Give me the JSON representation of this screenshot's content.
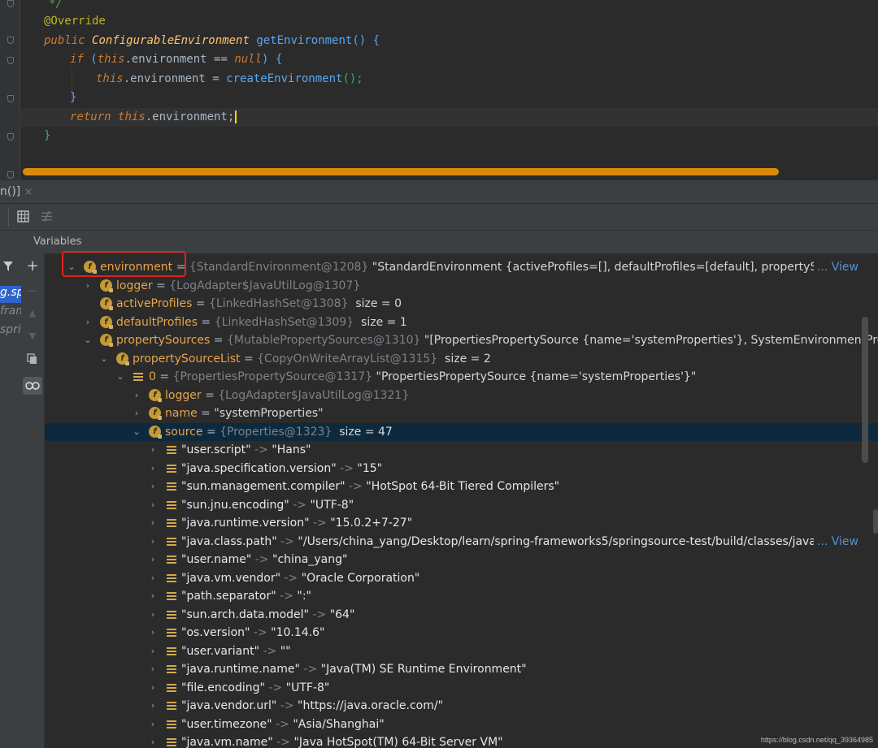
{
  "editor": {
    "lines": {
      "comment_end": "*/",
      "annotation": "@Override",
      "l_public": "public",
      "l_type": "ConfigurableEnvironment",
      "l_method": "getEnvironment",
      "l_parens": "()",
      "l_brace": "{",
      "if_kw": "if",
      "if_this": "this",
      "if_field": ".environment == ",
      "if_null": "null",
      "if_close": ") {",
      "if_open": "(",
      "assign_this": "this",
      "assign_field": ".environment = ",
      "assign_call": "createEnvironment",
      "assign_end": "();",
      "close_if": "}",
      "return_kw": "return",
      "return_this": "this",
      "return_field": ".environment;",
      "close_method": "}"
    },
    "scrollbar_color": "#d98a0a"
  },
  "debug": {
    "tab_label": "n()]",
    "tab_close": "×",
    "variables_title": "Variables",
    "frames": [
      {
        "label": "g.sp",
        "selected": true
      },
      {
        "label": "fram",
        "selected": false
      },
      {
        "label": "spri",
        "selected": false
      }
    ]
  },
  "tree": {
    "rows": [
      {
        "name": "environment",
        "ref": "{StandardEnvironment@1208}",
        "val": "\"StandardEnvironment {activeProfiles=[], defaultProfiles=[default], propertySource",
        "view": "... View"
      },
      {
        "name": "logger",
        "ref": "{LogAdapter$JavaUtilLog@1307}"
      },
      {
        "name": "activeProfiles",
        "ref": "{LinkedHashSet@1308}",
        "size": "size = 0"
      },
      {
        "name": "defaultProfiles",
        "ref": "{LinkedHashSet@1309}",
        "size": "size = 1"
      },
      {
        "name": "propertySources",
        "ref": "{MutablePropertySources@1310}",
        "val": "\"[PropertiesPropertySource {name='systemProperties'}, SystemEnvironmentPro"
      },
      {
        "name": "propertySourceList",
        "ref": "{CopyOnWriteArrayList@1315}",
        "size": "size = 2"
      },
      {
        "name": "0",
        "ref": "{PropertiesPropertySource@1317}",
        "val": "\"PropertiesPropertySource {name='systemProperties'}\""
      },
      {
        "name": "logger",
        "ref": "{LogAdapter$JavaUtilLog@1321}"
      },
      {
        "name": "name",
        "val": "\"systemProperties\""
      },
      {
        "name": "source",
        "ref": "{Properties@1323}",
        "size": "size = 47"
      }
    ],
    "entries": [
      {
        "k": "\"user.script\"",
        "v": "\"Hans\""
      },
      {
        "k": "\"java.specification.version\"",
        "v": "\"15\""
      },
      {
        "k": "\"sun.management.compiler\"",
        "v": "\"HotSpot 64-Bit Tiered Compilers\""
      },
      {
        "k": "\"sun.jnu.encoding\"",
        "v": "\"UTF-8\""
      },
      {
        "k": "\"java.runtime.version\"",
        "v": "\"15.0.2+7-27\""
      },
      {
        "k": "\"java.class.path\"",
        "v": "\"/Users/china_yang/Desktop/learn/spring-frameworks5/springsource-test/build/classes/java/n",
        "view": "... View"
      },
      {
        "k": "\"user.name\"",
        "v": "\"china_yang\""
      },
      {
        "k": "\"java.vm.vendor\"",
        "v": "\"Oracle Corporation\""
      },
      {
        "k": "\"path.separator\"",
        "v": "\":\""
      },
      {
        "k": "\"sun.arch.data.model\"",
        "v": "\"64\""
      },
      {
        "k": "\"os.version\"",
        "v": "\"10.14.6\""
      },
      {
        "k": "\"user.variant\"",
        "v": "\"\""
      },
      {
        "k": "\"java.runtime.name\"",
        "v": "\"Java(TM) SE Runtime Environment\""
      },
      {
        "k": "\"file.encoding\"",
        "v": "\"UTF-8\""
      },
      {
        "k": "\"java.vendor.url\"",
        "v": "\"https://java.oracle.com/\""
      },
      {
        "k": "\"user.timezone\"",
        "v": "\"Asia/Shanghai\""
      },
      {
        "k": "\"java.vm.name\"",
        "v": "\"Java HotSpot(TM) 64-Bit Server VM\""
      }
    ],
    "arrow": "->",
    "eq": "="
  },
  "watermark": "https://blog.csdn.net/qq_39364985"
}
